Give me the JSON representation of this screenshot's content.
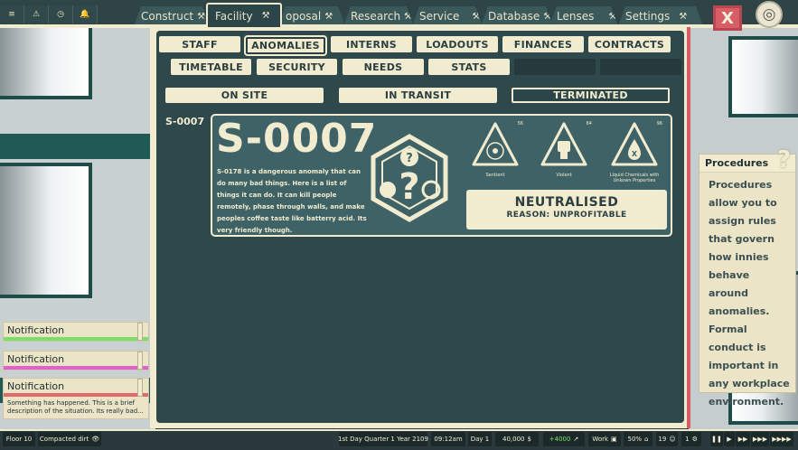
{
  "topnav": {
    "quick": [
      {
        "icon": "list-icon",
        "glyph": "≡"
      },
      {
        "icon": "warning-icon",
        "glyph": "⚠"
      },
      {
        "icon": "clock-icon",
        "glyph": "◷"
      },
      {
        "icon": "bell-icon",
        "glyph": "🔔"
      }
    ],
    "tabs": [
      {
        "label": "Construct",
        "icon": "hammer-wrench-icon"
      },
      {
        "label": "Facility",
        "icon": "hammer-wrench-icon",
        "active": true
      },
      {
        "label": "oposal",
        "icon": "hammer-wrench-icon"
      },
      {
        "label": "Research",
        "icon": "hammer-wrench-icon"
      },
      {
        "label": "Service",
        "icon": "hammer-wrench-icon"
      },
      {
        "label": "Database",
        "icon": "hammer-wrench-icon"
      },
      {
        "label": "Lenses",
        "icon": "hammer-wrench-icon"
      },
      {
        "label": "Settings",
        "icon": "hammer-wrench-icon"
      }
    ],
    "close_label": "X",
    "accent_red": "#d85e66"
  },
  "subnav": {
    "row1": [
      "STAFF",
      "ANOMALIES",
      "INTERNS",
      "LOADOUTS",
      "FINANCES",
      "CONTRACTS"
    ],
    "row2": [
      "TIMETABLE",
      "SECURITY",
      "NEEDS",
      "STATS",
      "",
      ""
    ],
    "selected": "ANOMALIES"
  },
  "filters": {
    "items": [
      "ON SITE",
      "IN TRANSIT",
      "TERMINATED"
    ],
    "selected": "TERMINATED"
  },
  "anomaly": {
    "side_id": "S-0007",
    "title": "S-0007",
    "description": "S-0178 is a dangerous anomaly that can do many bad things. Here is a list of things it can do. It can kill people remotely, phase through walls, and make peoples coffee taste like batterry acid. Its very friendly though.",
    "hazards": [
      {
        "name": "Sentient",
        "number": "56",
        "icon": "brain-icon"
      },
      {
        "name": "Violent",
        "number": "64",
        "icon": "fist-icon"
      },
      {
        "name": "Liquid Chemicals with Unkown Properties",
        "number": "96",
        "icon": "chemical-drop-icon"
      }
    ],
    "status": "NEUTRALISED",
    "reason": "REASON:  UNPROFITABLE"
  },
  "procedures": {
    "title": "Procedures",
    "text": "Procedures allow you to assign rules that govern how innies behave around anomalies. Formal conduct is important in any workplace environment."
  },
  "notifications": [
    {
      "title": "Notification",
      "color": "#7be06a"
    },
    {
      "title": "Notification",
      "color": "#e25fd0"
    },
    {
      "title": "Notification",
      "color": "#e06a6a",
      "body": "Something has happened.  This is a brief description of the situation. Its really bad..."
    }
  ],
  "bottombar": {
    "floor": "Floor 10",
    "terrain": "Compacted dirt",
    "date": "1st Day Quarter 1 Year 2109",
    "time": "09:12am",
    "day": "Day 1",
    "money": "40,000",
    "income": "+4000",
    "mode": "Work",
    "percent": "50%",
    "staff_count": "19",
    "alert_count": "1",
    "speed_controls": [
      "❚❚",
      "▶",
      "▶▶",
      "▶▶▶",
      "▶▶▶▶"
    ]
  }
}
